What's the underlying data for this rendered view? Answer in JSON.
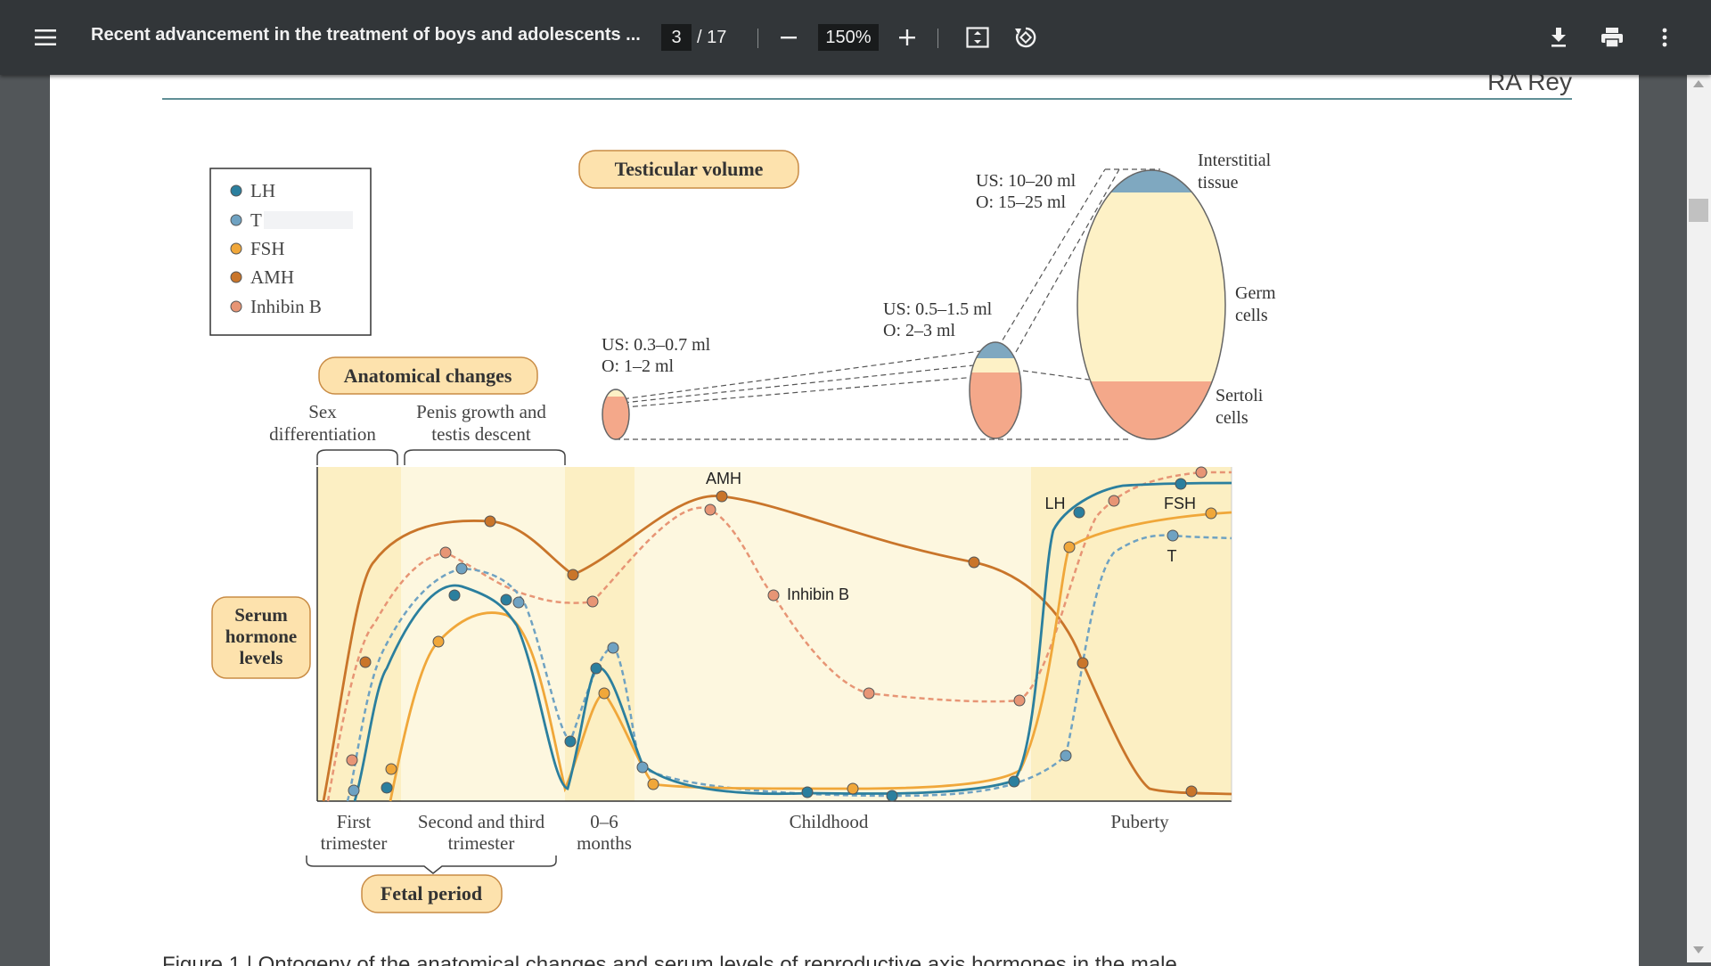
{
  "viewer": {
    "doc_title": "Recent advancement in the treatment of boys and adolescents ...",
    "current_page": "3",
    "total_pages": "/ 17",
    "zoom": "150%",
    "icons": [
      "menu-icon",
      "zoom-out-icon",
      "zoom-in-icon",
      "fit-page-icon",
      "rotate-icon",
      "download-icon",
      "print-icon",
      "more-vert-icon"
    ]
  },
  "page": {
    "header_author": "RA Rey",
    "caption_fragment": "Figure 1 | Ontogeny of the anatomical changes and serum levels of reproductive axis hormones in the male.",
    "legend": {
      "lh": "LH",
      "t": "T",
      "fsh": "FSH",
      "amh": "AMH",
      "inhibin": "Inhibin B"
    },
    "testicular_volume_label": "Testicular volume",
    "vol_small_us": "US: 0.3–0.7 ml",
    "vol_small_o": "O: 1–2 ml",
    "vol_mid_us": "US: 0.5–1.5 ml",
    "vol_mid_o": "O: 2–3 ml",
    "vol_large_us": "US: 10–20 ml",
    "vol_large_o": "O: 15–25 ml",
    "interstitial_1": "Interstitial",
    "interstitial_2": "tissue",
    "germ_1": "Germ",
    "germ_2": "cells",
    "sertoli_1": "Sertoli",
    "sertoli_2": "cells",
    "anatomical_changes": "Anatomical changes",
    "sex_diff_1": "Sex",
    "sex_diff_2": "differentiation",
    "penis_1": "Penis growth and",
    "penis_2": "testis descent",
    "serum_1": "Serum",
    "serum_2": "hormone",
    "serum_3": "levels",
    "curve_amh": "AMH",
    "curve_inhibin": "Inhibin B",
    "curve_lh": "LH",
    "curve_fsh": "FSH",
    "curve_t": "T",
    "first_tri_1": "First",
    "first_tri_2": "trimester",
    "second_tri_1": "Second and third",
    "second_tri_2": "trimester",
    "months_1": "0–6",
    "months_2": "months",
    "childhood": "Childhood",
    "puberty": "Puberty",
    "fetal_period": "Fetal period"
  },
  "colors": {
    "lh": "#2b7f9e",
    "t": "#6fa2c2",
    "fsh": "#f0a73a",
    "amh": "#c9752a",
    "inhibin": "#e79575",
    "pale_bg": "#fdf7df",
    "band_bg": "#fcefc3",
    "pill_fill": "#fde2ad",
    "pill_stroke": "#c98c45"
  }
}
